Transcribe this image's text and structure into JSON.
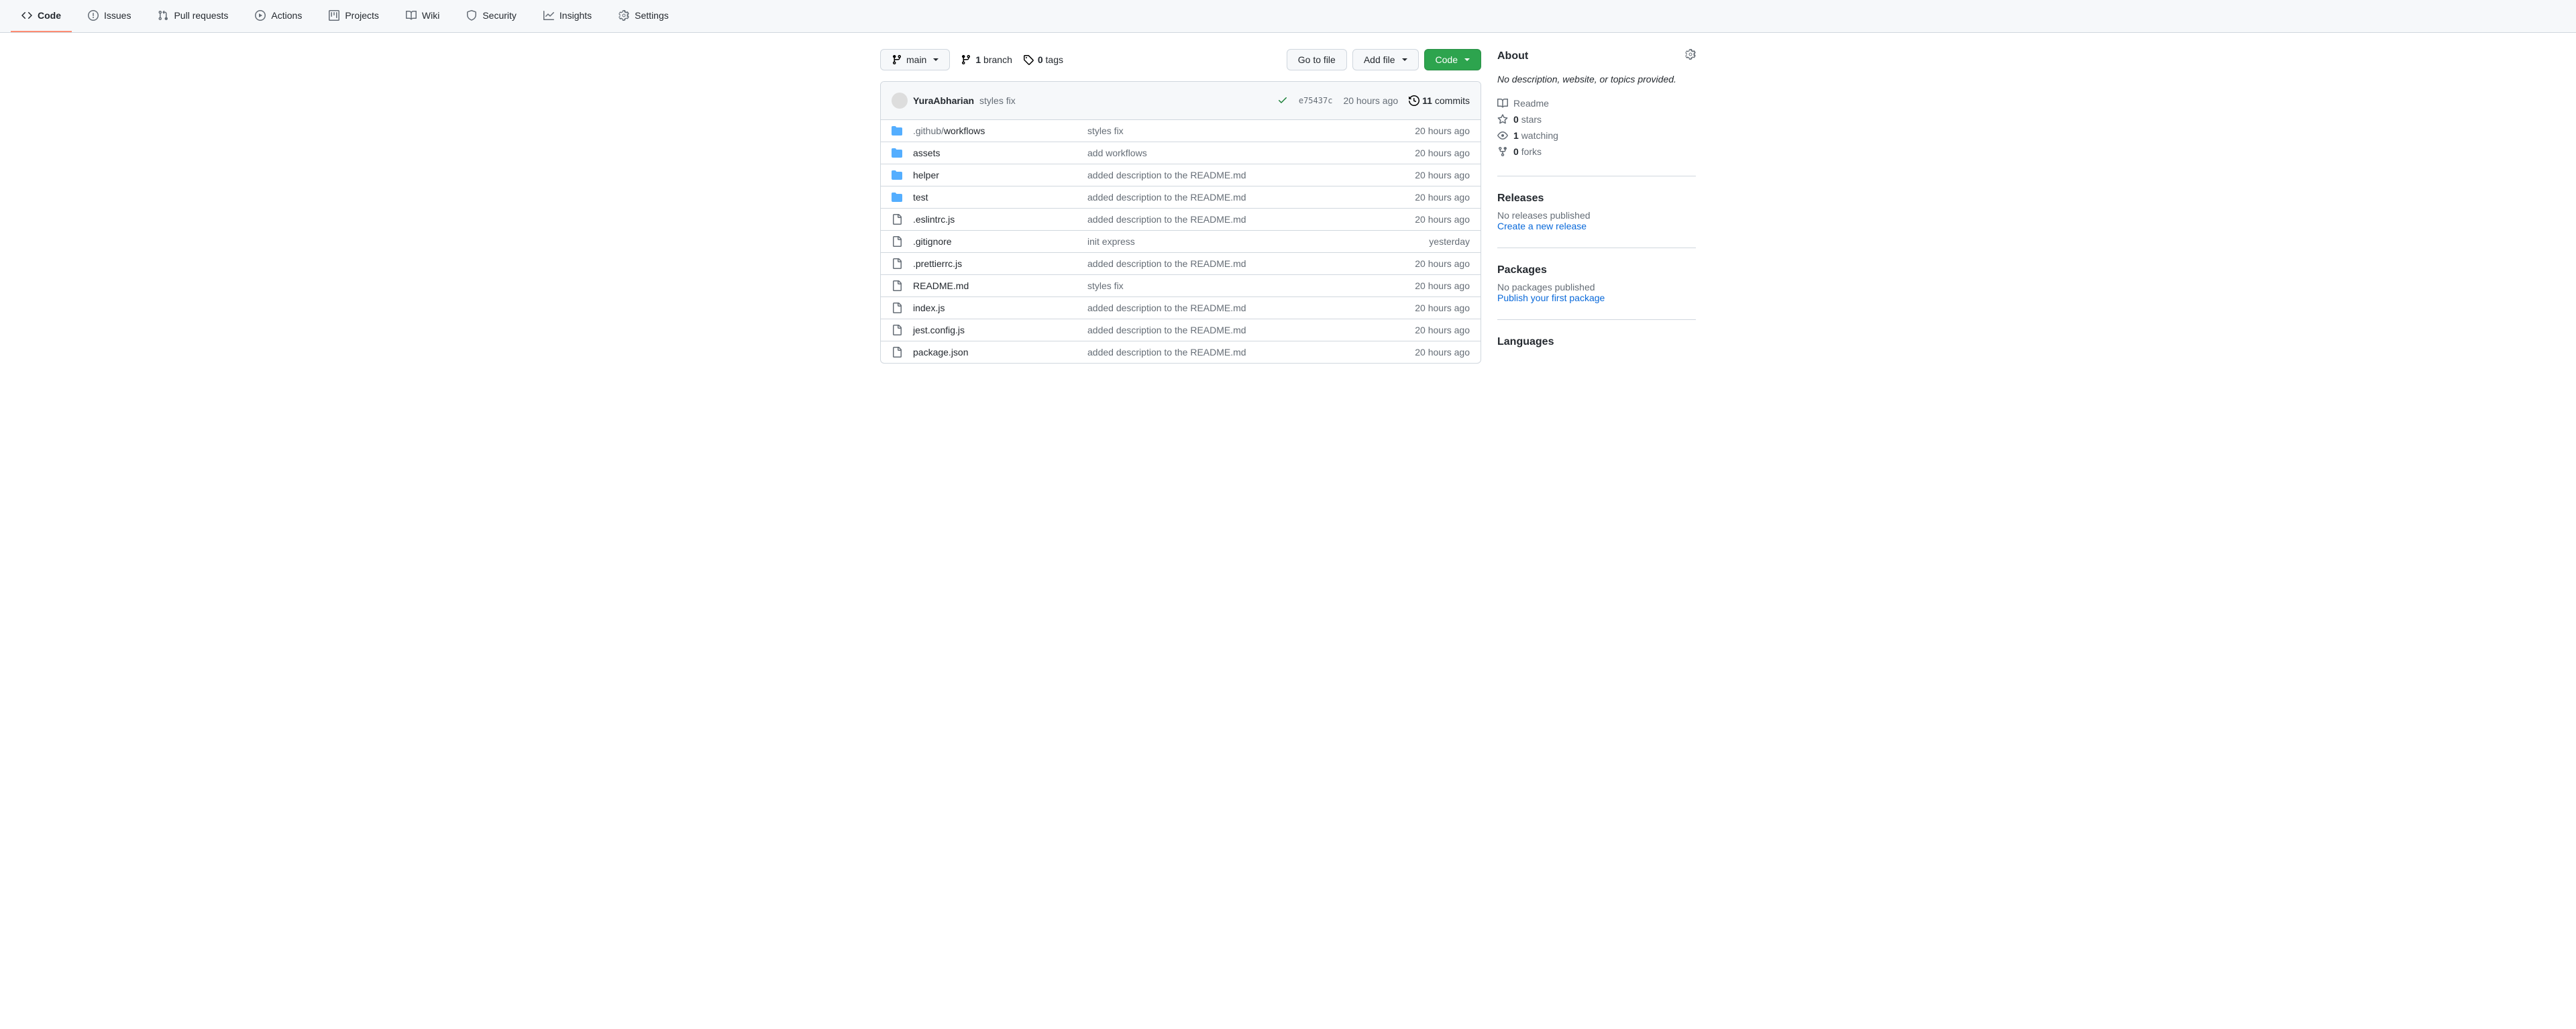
{
  "tabs": [
    {
      "label": "Code",
      "icon": "code"
    },
    {
      "label": "Issues",
      "icon": "issue"
    },
    {
      "label": "Pull requests",
      "icon": "pr"
    },
    {
      "label": "Actions",
      "icon": "play"
    },
    {
      "label": "Projects",
      "icon": "table"
    },
    {
      "label": "Wiki",
      "icon": "book"
    },
    {
      "label": "Security",
      "icon": "shield"
    },
    {
      "label": "Insights",
      "icon": "graph"
    },
    {
      "label": "Settings",
      "icon": "gear"
    }
  ],
  "branch": {
    "name": "main",
    "count": "1",
    "label": "branch"
  },
  "tags": {
    "count": "0",
    "label": "tags"
  },
  "buttons": {
    "goto": "Go to file",
    "add": "Add file",
    "code": "Code"
  },
  "commit": {
    "author": "YuraAbharian",
    "message": "styles fix",
    "hash": "e75437c",
    "time": "20 hours ago",
    "count": "11",
    "count_label": "commits"
  },
  "files": [
    {
      "type": "dir",
      "name_prefix": ".github/",
      "name": "workflows",
      "msg": "styles fix",
      "time": "20 hours ago"
    },
    {
      "type": "dir",
      "name": "assets",
      "msg": "add workflows",
      "time": "20 hours ago"
    },
    {
      "type": "dir",
      "name": "helper",
      "msg": "added description to the README.md",
      "time": "20 hours ago"
    },
    {
      "type": "dir",
      "name": "test",
      "msg": "added description to the README.md",
      "time": "20 hours ago"
    },
    {
      "type": "file",
      "name": ".eslintrc.js",
      "msg": "added description to the README.md",
      "time": "20 hours ago"
    },
    {
      "type": "file",
      "name": ".gitignore",
      "msg": "init express",
      "time": "yesterday"
    },
    {
      "type": "file",
      "name": ".prettierrc.js",
      "msg": "added description to the README.md",
      "time": "20 hours ago"
    },
    {
      "type": "file",
      "name": "README.md",
      "msg": "styles fix",
      "time": "20 hours ago"
    },
    {
      "type": "file",
      "name": "index.js",
      "msg": "added description to the README.md",
      "time": "20 hours ago"
    },
    {
      "type": "file",
      "name": "jest.config.js",
      "msg": "added description to the README.md",
      "time": "20 hours ago"
    },
    {
      "type": "file",
      "name": "package.json",
      "msg": "added description to the README.md",
      "time": "20 hours ago"
    }
  ],
  "about": {
    "heading": "About",
    "description": "No description, website, or topics provided.",
    "readme": "Readme",
    "stars_count": "0",
    "stars_label": "stars",
    "watching_count": "1",
    "watching_label": "watching",
    "forks_count": "0",
    "forks_label": "forks"
  },
  "releases": {
    "heading": "Releases",
    "empty": "No releases published",
    "cta": "Create a new release"
  },
  "packages": {
    "heading": "Packages",
    "empty": "No packages published",
    "cta": "Publish your first package"
  },
  "languages": {
    "heading": "Languages"
  }
}
